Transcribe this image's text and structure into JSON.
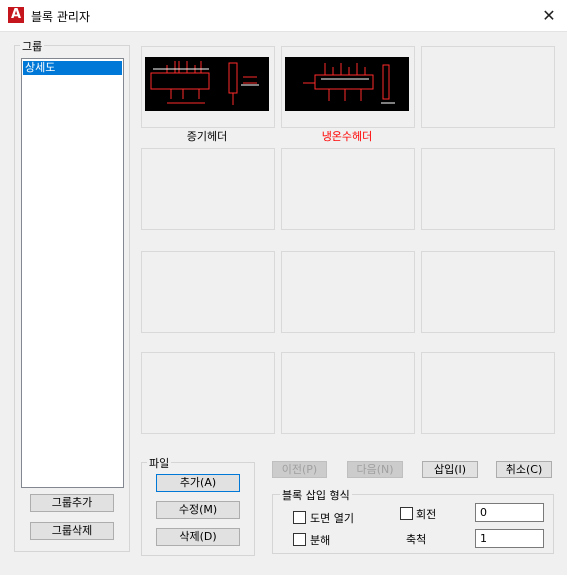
{
  "window": {
    "title": "블록 관리자",
    "close": "✕"
  },
  "group": {
    "legend": "그룹",
    "items": [
      "상세도"
    ],
    "add_button": "그룹추가",
    "delete_button": "그룹삭제"
  },
  "thumbnails": [
    {
      "caption": "증기헤더",
      "caption_color": "#000000"
    },
    {
      "caption": "냉온수헤더",
      "caption_color": "#ff0000"
    }
  ],
  "file": {
    "legend": "파일",
    "add_button": "추가(A)",
    "edit_button": "수정(M)",
    "delete_button": "삭제(D)"
  },
  "nav": {
    "prev_button": "이전(P)",
    "next_button": "다음(N)",
    "insert_button": "삽입(I)",
    "cancel_button": "취소(C)"
  },
  "insert_options": {
    "legend": "블록 삽입 형식",
    "open_drawing_label": "도면 열기",
    "explode_label": "분해",
    "rotate_label": "회전",
    "rotate_value": "0",
    "scale_label": "축척",
    "scale_value": "1"
  }
}
